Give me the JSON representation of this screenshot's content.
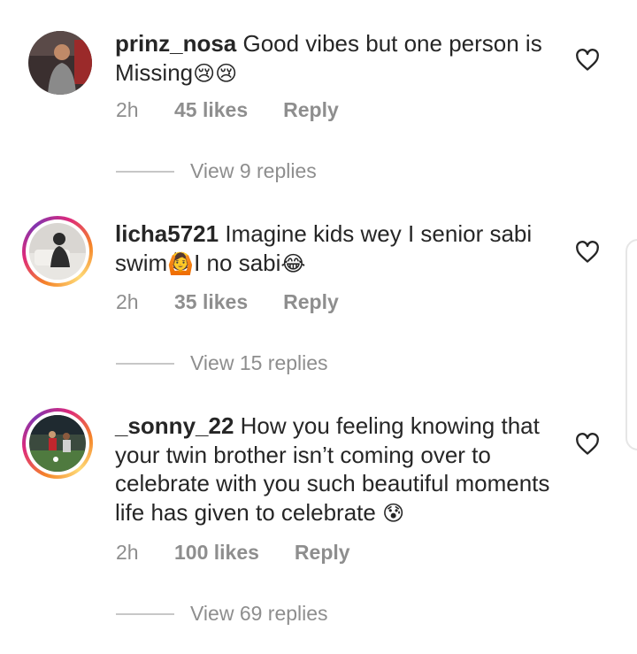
{
  "comments": [
    {
      "username": "prinz_nosa",
      "text": "Good vibes but one person is Missing",
      "emoji": "😢😢",
      "time": "2h",
      "likes": "45 likes",
      "reply": "Reply",
      "view_replies": "View 9 replies"
    },
    {
      "username": "licha5721",
      "text_a": "Imagine kids wey I senior sabi swim",
      "emoji_a": "🙆",
      "text_b": "I no sabi",
      "emoji_b": "😂",
      "time": "2h",
      "likes": "35 likes",
      "reply": "Reply",
      "view_replies": "View 15 replies"
    },
    {
      "username": "_sonny_22",
      "text": "How you feeling knowing that your twin brother isn’t coming over to celebrate with you such beautiful moments life has given to celebrate",
      "emoji": "😰",
      "time": "2h",
      "likes": "100 likes",
      "reply": "Reply",
      "view_replies": "View 69 replies"
    }
  ],
  "icons": {
    "like": "heart-outline-icon"
  },
  "colors": {
    "primary_text": "#262626",
    "secondary_text": "#8e8e8e",
    "story_ring": "#dd2a7b"
  }
}
